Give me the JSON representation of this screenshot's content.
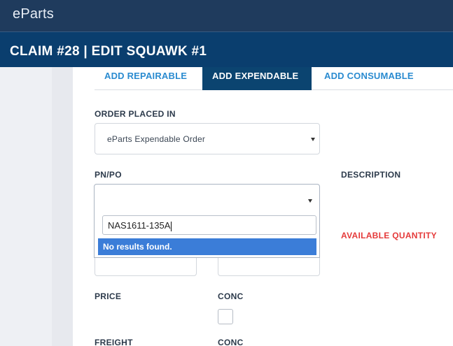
{
  "app": {
    "logo": "eParts"
  },
  "header": {
    "title": "CLAIM #28 | EDIT SQUAWK #1"
  },
  "tabs": [
    {
      "label": "ADD REPAIRABLE",
      "active": false
    },
    {
      "label": "ADD EXPENDABLE",
      "active": true
    },
    {
      "label": "ADD CONSUMABLE",
      "active": false
    }
  ],
  "form": {
    "order_placed_in": {
      "label": "ORDER PLACED IN",
      "value": "eParts Expendable Order"
    },
    "pn_po": {
      "label": "PN/PO",
      "value": ""
    },
    "description": {
      "label": "DESCRIPTION"
    },
    "available_quantity": {
      "label": "AVAILABLE QUANTITY"
    },
    "price": {
      "label": "PRICE"
    },
    "conc_1": {
      "label": "CONC",
      "checked": false
    },
    "freight": {
      "label": "FREIGHT"
    },
    "conc_2": {
      "label": "CONC"
    }
  },
  "dropdown": {
    "search_value": "NAS1611-135A",
    "message": "No results found."
  },
  "colors": {
    "topbar": "#1f3b5d",
    "titlebar": "#0a3e6e",
    "tab_active": "#0b4470",
    "tab_link": "#2a8bd0",
    "highlight": "#3b7dd8",
    "warning": "#e53a3a"
  }
}
